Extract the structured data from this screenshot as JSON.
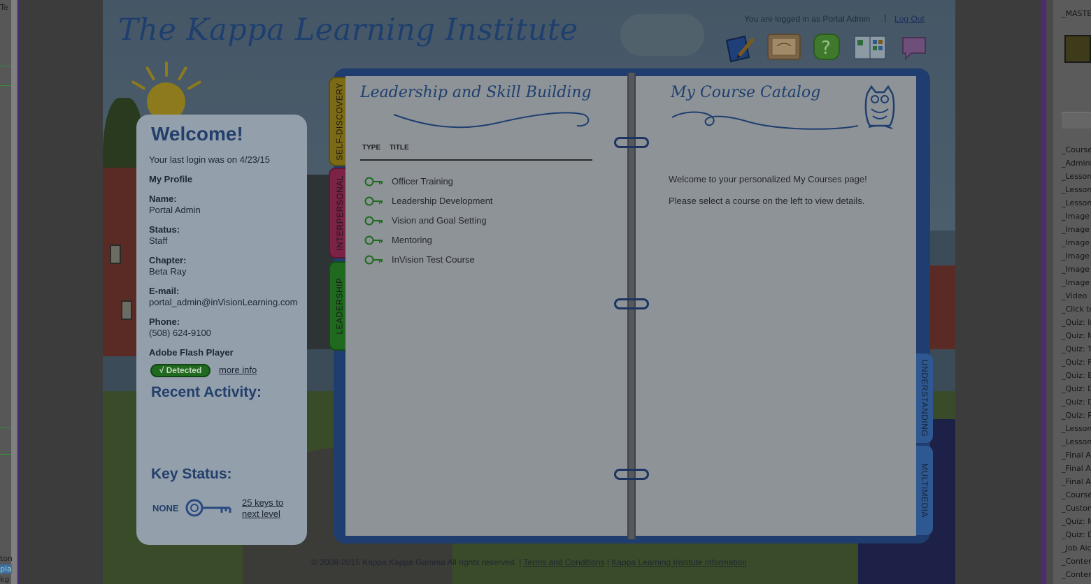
{
  "header": {
    "brand": "The Kappa Learning Institute",
    "login_status": "You are logged in as Portal Admin",
    "separator": "|",
    "logout": "Log Out"
  },
  "toolbar_icons": [
    {
      "name": "journal-pencil-icon"
    },
    {
      "name": "certificate-icon"
    },
    {
      "name": "help-icon"
    },
    {
      "name": "catalog-book-icon"
    },
    {
      "name": "chat-bubble-icon"
    }
  ],
  "welcome": {
    "title": "Welcome!",
    "last_login": "Your last login was on 4/23/15",
    "profile_heading": "My Profile",
    "name_label": "Name:",
    "name_value": "Portal Admin",
    "status_label": "Status:",
    "status_value": "Staff",
    "chapter_label": "Chapter:",
    "chapter_value": "Beta Ray",
    "email_label": "E-mail:",
    "email_value": "portal_admin@inVisionLearning.com",
    "phone_label": "Phone:",
    "phone_value": "(508) 624-9100",
    "flash_label": "Adobe Flash Player",
    "flash_status": "√ Detected",
    "more_info": "more info",
    "recent_activity": "Recent Activity:",
    "key_status": "Key Status:",
    "key_level": "NONE",
    "keys_to_next_1": "25 keys to",
    "keys_to_next_2": "next level"
  },
  "binder": {
    "left_tabs": [
      "SELF-DISCOVERY",
      "INTERPERSONAL",
      "LEADERSHIP"
    ],
    "right_tabs": [
      "UNDERSTANDING",
      "MULTIMEDIA"
    ],
    "section_title": "Leadership and Skill Building",
    "columns": [
      "TYPE",
      "TITLE"
    ],
    "courses": [
      "Officer Training",
      "Leadership Development",
      "Vision and Goal Setting",
      "Mentoring",
      "InVision Test Course"
    ],
    "catalog_title": "My Course Catalog",
    "catalog_welcome": "Welcome to your personalized My Courses page!",
    "catalog_select": "Please select a course on the left to view details."
  },
  "footer": {
    "copyright": "© 2008-2015 Kappa Kappa Gamma All rights reserved. |",
    "terms": "Terms and Conditions",
    "sep": "|",
    "info": "Kappa Learning Institute Information"
  },
  "editor": {
    "left_text_1": "Te",
    "left_text_2": "ton",
    "left_text_3": "pla",
    "left_text_4": "kg",
    "right_master": "_MASTER",
    "right_layers": [
      "_Course",
      "_Adminis",
      "_Lesson",
      "_Lesson",
      "_Lesson",
      "_Image I",
      "_Image T",
      "_Image I",
      "_Image I",
      "_Image I",
      "_Image I",
      "_Video",
      "_Click to",
      "_Quiz: Ir",
      "_Quiz: M",
      "_Quiz: Ti",
      "_Quiz: Fi",
      "_Quiz: E",
      "_Quiz: D",
      "_Quiz: D",
      "_Quiz: R",
      "_Lesson",
      "_Lesson",
      "_Final As",
      "_Final As",
      "_Final As",
      "_Course",
      "_Custom",
      "_Quiz: M",
      "_Quiz: D",
      "_Job Aic",
      "_Conten",
      "_Conten"
    ]
  }
}
